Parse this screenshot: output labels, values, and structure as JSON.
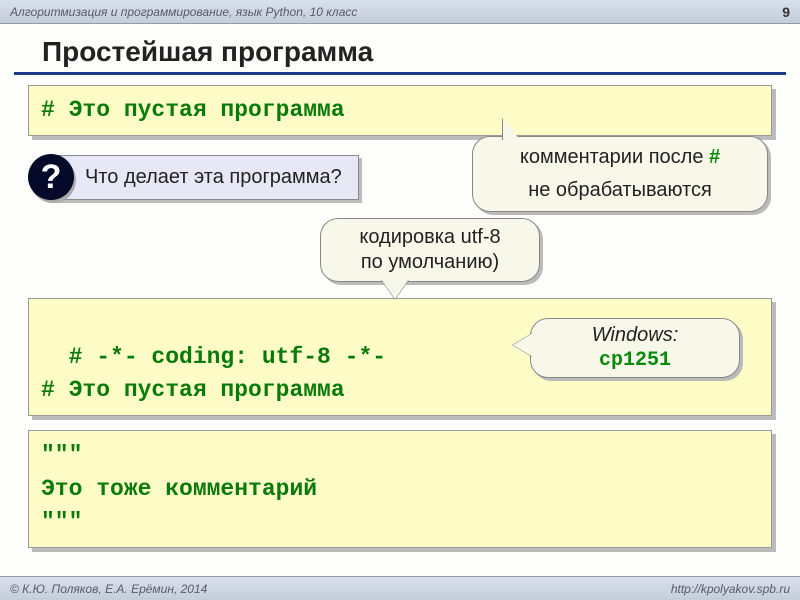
{
  "header": {
    "course": "Алгоритмизация и программирование, язык Python, 10 класс",
    "page": "9"
  },
  "title": "Простейшая программа",
  "code1": "# Это пустая программа",
  "question": {
    "mark": "?",
    "text": "Что делает эта программа?"
  },
  "callout_comment": {
    "line1_pre": "комментарии после ",
    "hash": "#",
    "line2": "не обрабатываются"
  },
  "callout_utf8": {
    "line1": "кодировка utf-8",
    "line2": "по умолчанию)"
  },
  "code2": "# -*- coding: utf-8 -*-\n# Это пустая программа",
  "callout_win": {
    "label": "Windows:",
    "value": "cp1251"
  },
  "code3": "\"\"\"\nЭто тоже комментарий\n\"\"\"",
  "footer": {
    "authors": "© К.Ю. Поляков, Е.А. Ерёмин, 2014",
    "url": "http://kpolyakov.spb.ru"
  }
}
